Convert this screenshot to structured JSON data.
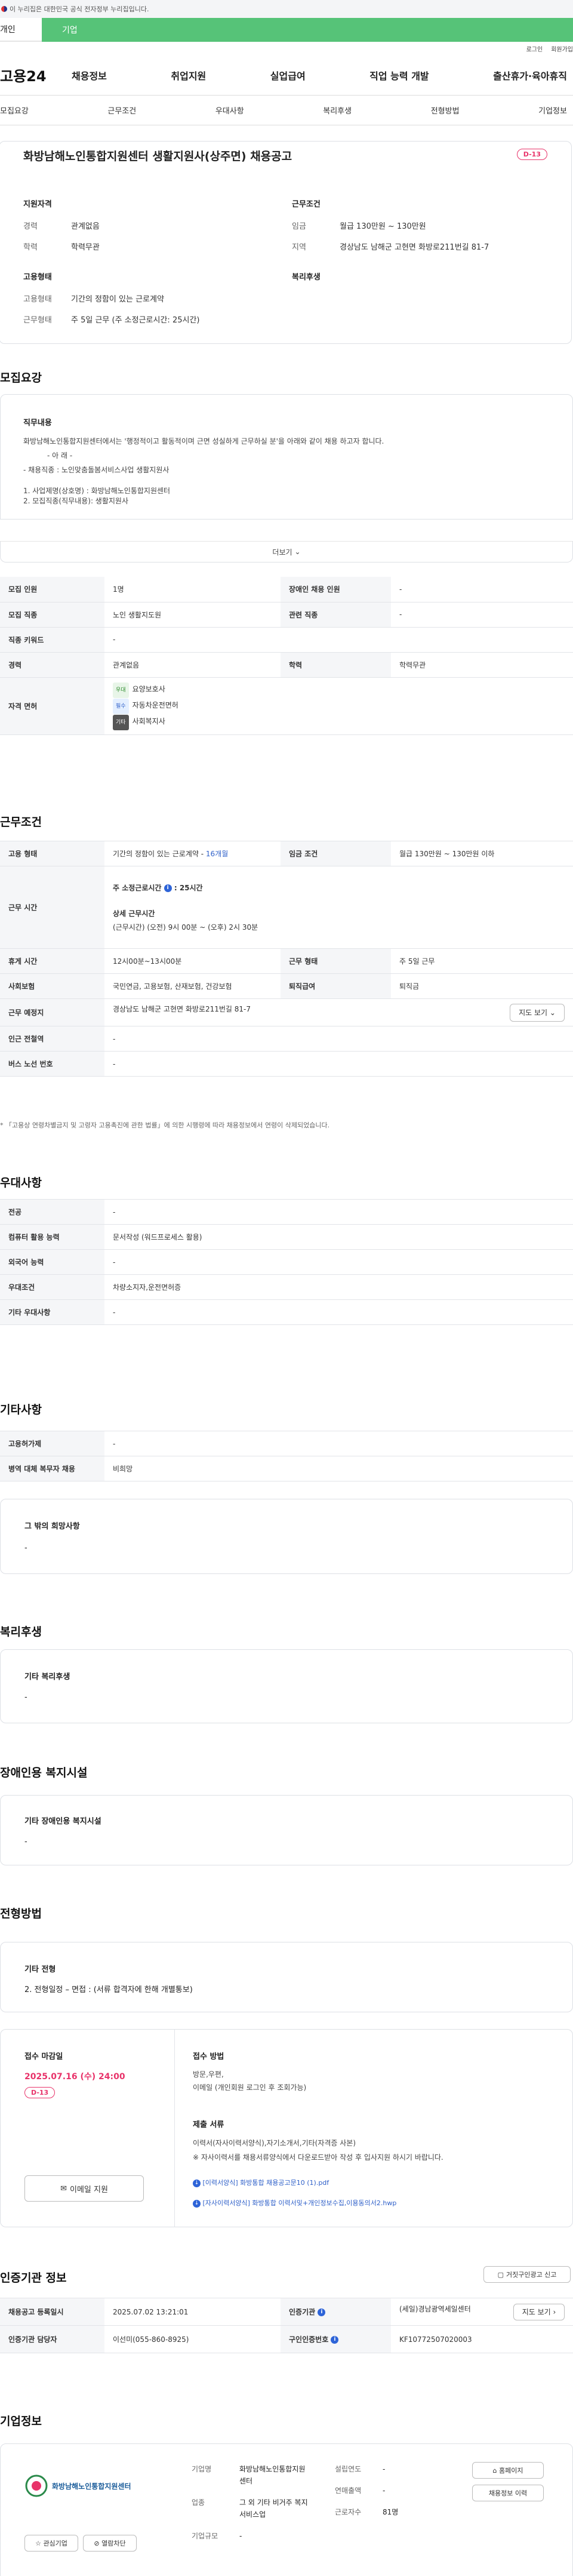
{
  "gov_banner": "이 누리집은 대한민국 공식 전자정부 누리집입니다.",
  "ctabs": [
    "개인",
    "기업"
  ],
  "util": [
    "로그인",
    "회원가입"
  ],
  "logo": "고용24",
  "gnb": [
    "채용정보",
    "취업지원",
    "실업급여",
    "직업 능력 개발",
    "출산휴가·육아휴직"
  ],
  "lnb": [
    "모집요강",
    "근무조건",
    "우대사항",
    "복리후생",
    "전형방법",
    "기업정보"
  ],
  "job": {
    "title": "화방남해노인통합지원센터 생활지원사(상주면) 채용공고",
    "dday": "D-13",
    "qual_title": "지원자격",
    "cond_title": "근무조건",
    "emp_title": "고용형태",
    "welfare_title": "복리후생",
    "qual": [
      {
        "k": "경력",
        "v": "관계없음"
      },
      {
        "k": "학력",
        "v": "학력무관"
      }
    ],
    "cond": [
      {
        "k": "임금",
        "v": "월급 130만원 ~ 130만원"
      },
      {
        "k": "지역",
        "v": "경상남도 남해군 고현면 화방로211번길 81-7"
      }
    ],
    "emp": [
      {
        "k": "고용형태",
        "v": "기간의 정함이 있는 근로계약"
      },
      {
        "k": "근무형태",
        "v": "주 5일 근무 (주 소정근로시간: 25시간)"
      }
    ]
  },
  "recruit": {
    "title": "모집요강",
    "desc_title": "직무내용",
    "desc": [
      "화방남해노인통합지원센터에서는 '행정적이고 활동적이며 근면 성실하게 근무하실 분'을 아래와 같이 채용 하고자 합니다.",
      "- 아 래 -",
      "- 채용직종 : 노인맞춤돌봄서비스사업  생활지원사",
      "1. 사업제명(상호명) : 화방남해노인통합지원센터",
      "2. 모집직종(직무내용): 생활지원사"
    ],
    "more": "더보기",
    "rows": {
      "count_k": "모집 인원",
      "count_v": "1명",
      "disabled_k": "장애인 채용 인원",
      "disabled_v": "-",
      "job_k": "모집 직종",
      "job_v": "노인 생활지도원",
      "related_k": "관련 직종",
      "related_v": "-",
      "kw_k": "직종 키워드",
      "kw_v": "-",
      "career_k": "경력",
      "career_v": "관계없음",
      "edu_k": "학력",
      "edu_v": "학력무관",
      "lic_k": "자격 면허",
      "lic": [
        {
          "tag": "우대",
          "name": "요양보호사"
        },
        {
          "tag": "필수",
          "name": "자동차운전면허"
        },
        {
          "tag": "기타",
          "name": "사회복지사"
        }
      ]
    }
  },
  "work": {
    "title": "근무조건",
    "type_k": "고용 형태",
    "type_v": "기간의 정함이 있는 근로계약 - ",
    "type_month": "16개월",
    "pay_k": "임금 조건",
    "pay_v": "월급 130만원 ~ 130만원 이하",
    "time_k": "근무 시간",
    "week_hours": "주 소정근로시간",
    "week_hours_v": ": 25시간",
    "detail_title": "상세 근무시간",
    "detail_v": "(근무시간) (오전) 9시 00분 ~ (오후) 2시 30분",
    "rest_k": "휴게 시간",
    "rest_v": "12시00분~13시00분",
    "form_k": "근무 형태",
    "form_v": "주 5일 근무",
    "ins_k": "사회보험",
    "ins_v": "국민연금, 고용보험, 산재보험, 건강보험",
    "retire_k": "퇴직급여",
    "retire_v": "퇴직금",
    "place_k": "근무 예정지",
    "place_v": "경상남도 남해군 고현면 화방로211번길 81-7",
    "map_btn": "지도 보기",
    "subway_k": "인근 전철역",
    "subway_v": "-",
    "bus_k": "버스 노선 번호",
    "bus_v": "-",
    "note": "* 「고용상 연령차별금지 및 고령자 고용촉진에 관한 법률」에 의한 시행령에 따라 채용정보에서 연령이 삭제되었습니다."
  },
  "pref": {
    "title": "우대사항",
    "rows": [
      {
        "k": "전공",
        "v": "-"
      },
      {
        "k": "컴퓨터 활용 능력",
        "v": "문서작성 (워드프로세스 활용)"
      },
      {
        "k": "외국어 능력",
        "v": "-"
      },
      {
        "k": "우대조건",
        "v": "차량소지자,운전면허증"
      },
      {
        "k": "기타 우대사항",
        "v": "-"
      }
    ]
  },
  "etc": {
    "title": "기타사항",
    "rows": [
      {
        "k": "고용허가제",
        "v": "-"
      },
      {
        "k": "병역 대체 복무자 채용",
        "v": "비희망"
      }
    ],
    "box_title": "그 밖의 희망사항",
    "box_v": "-"
  },
  "benefit": {
    "title": "복리후생",
    "box_title": "기타 복리후생",
    "box_v": "-"
  },
  "disab": {
    "title": "장애인용 복지시설",
    "box_title": "기타 장애인용 복지시설",
    "box_v": "-"
  },
  "select": {
    "title": "전형방법",
    "box_title": "기타 전형",
    "box_v": "2. 전형일정 – 면접 : (서류 합격자에 한해 개별통보)",
    "deadline_title": "접수 마감일",
    "deadline": "2025.07.16 (수) 24:00",
    "dday": "D-13",
    "email_btn": "이메일 지원",
    "method_title": "접수 방법",
    "method": [
      "방문,우편,",
      "이메일 (개인회원 로그인 후 조회가능)"
    ],
    "docs_title": "제출 서류",
    "docs": [
      "이력서(자사이력서양식),자기소개서,기타(자격증 사본)",
      "※ 자사이력서를 채용서류양식에서 다운로드받아 작성 후 입사지원 하시기 바랍니다."
    ],
    "files": [
      "[이력서양식] 화방통합 채용공고문10 (1).pdf",
      "[자사이력서양식] 화방통합 이력서및+개인정보수집,이용동의서2.hwp"
    ]
  },
  "cert": {
    "title": "인증기관 정보",
    "btn": "거짓구인광고 신고",
    "reg_k": "채용공고 등록일시",
    "reg_v": "2025.07.02 13:21:01",
    "org_k": "인증기관",
    "org_v": "(세일)경남광역세일센터",
    "map_btn": "지도 보기",
    "staff_k": "인증기관 담당자",
    "staff_v": "이선미(055-860-8925)",
    "num_k": "구인인증번호",
    "num_v": "KF10772507020003"
  },
  "company": {
    "title": "기업정보",
    "logo_text": "화방남해노인통합지원센터",
    "name_k": "기업명",
    "name_v": "화방남해노인통합지원센터",
    "year_k": "설립연도",
    "year_v": "-",
    "sales_k": "연매출액",
    "sales_v": "-",
    "ind_k": "업종",
    "ind_v": "그 외 기타 비거주 복지 서비스업",
    "emp_k": "근로자수",
    "emp_v": "81명",
    "scale_k": "기업규모",
    "scale_v": "-",
    "btns": [
      "관심기업",
      "열람차단"
    ],
    "side_btns": [
      "홈페이지",
      "채용정보 이력"
    ]
  }
}
